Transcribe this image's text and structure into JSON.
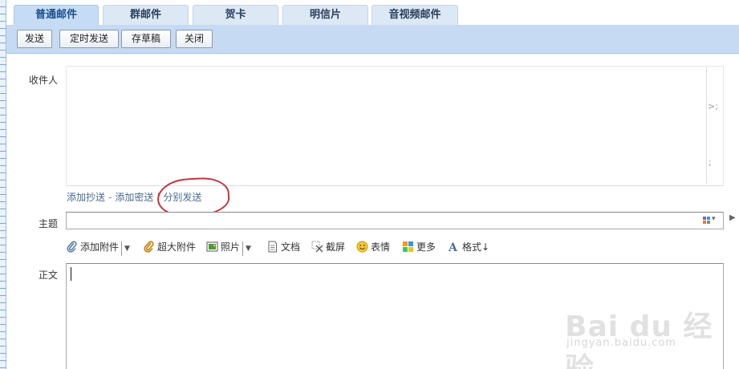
{
  "tabs": [
    {
      "label": "普通邮件",
      "active": true
    },
    {
      "label": "群邮件",
      "active": false
    },
    {
      "label": "贺卡",
      "active": false
    },
    {
      "label": "明信片",
      "active": false
    },
    {
      "label": "音视频邮件",
      "active": false
    }
  ],
  "toolbar": {
    "send": "发送",
    "scheduled_send": "定时发送",
    "save_draft": "存草稿",
    "close": "关闭"
  },
  "recipient": {
    "label": "收件人",
    "trail_1": ">;",
    "trail_2": ";"
  },
  "recipient_links": {
    "add_cc": "添加抄送",
    "dash": "-",
    "add_bcc": "添加密送",
    "bar": "|",
    "separate_send": "分别发送"
  },
  "subject": {
    "label": "主题",
    "value": ""
  },
  "attachments": {
    "add_attachment": "添加附件",
    "large_attachment": "超大附件",
    "photo": "照片",
    "document": "文档",
    "screenshot": "截屏",
    "emoji": "表情",
    "more": "更多",
    "format": "格式↓"
  },
  "body": {
    "label": "正文",
    "value": ""
  },
  "watermark": {
    "logo": "Bai du 经验",
    "url": "jingyan.baidu.com"
  },
  "colors": {
    "toolbar_bg": "#c6daf3",
    "tab_bg": "#dde8f5",
    "annotation_circle": "#c8323c"
  }
}
